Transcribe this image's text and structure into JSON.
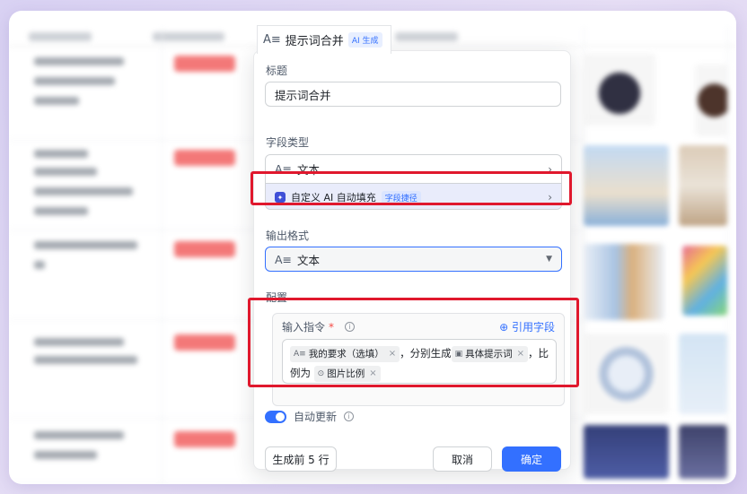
{
  "field_tab": {
    "title": "提示词合并",
    "ai_badge": "AI 生成"
  },
  "panel": {
    "title_label": "标题",
    "title_value": "提示词合并",
    "field_type_label": "字段类型",
    "field_type_value": "文本",
    "ai_fill_label": "自定义 AI 自动填充",
    "ai_fill_badge": "字段捷径",
    "output_format_label": "输出格式",
    "output_format_value": "文本",
    "config_label": "配置",
    "instruction_label": "输入指令",
    "required_mark": "*",
    "ref_field_link": "引用字段",
    "instruction": {
      "token1": "我的要求（选填）",
      "text1": "，分别生成",
      "token2": "具体提示词",
      "text2": "，比",
      "text3": "例为",
      "token3": "图片比例"
    },
    "auto_update_label": "自动更新",
    "gen_button": "生成前 5 行",
    "cancel_button": "取消",
    "ok_button": "确定"
  },
  "colors": {
    "accent": "#3370ff",
    "highlight": "#e0182d",
    "tag_red": "#f26a6a"
  }
}
